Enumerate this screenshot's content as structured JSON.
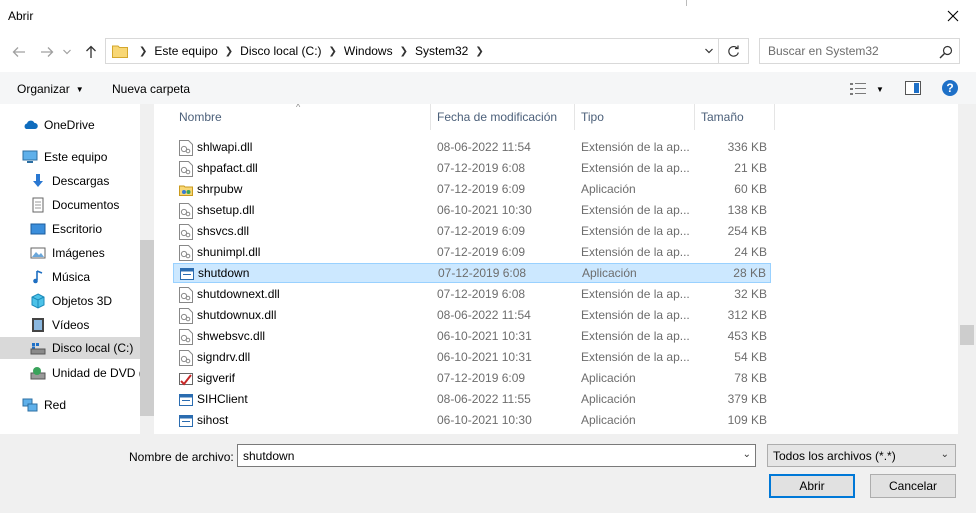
{
  "window": {
    "title": "Abrir"
  },
  "address": {
    "crumbs": [
      "Este equipo",
      "Disco local (C:)",
      "Windows",
      "System32"
    ]
  },
  "search": {
    "placeholder": "Buscar en System32"
  },
  "toolbar": {
    "organize_label": "Organizar",
    "new_folder_label": "Nueva carpeta"
  },
  "sidebar": {
    "items": [
      {
        "label": "OneDrive",
        "icon": "cloud-icon",
        "selected": false
      },
      {
        "label": "Este equipo",
        "icon": "computer-icon",
        "selected": false
      },
      {
        "label": "Descargas",
        "icon": "download-icon",
        "selected": false
      },
      {
        "label": "Documentos",
        "icon": "document-icon",
        "selected": false
      },
      {
        "label": "Escritorio",
        "icon": "desktop-icon",
        "selected": false
      },
      {
        "label": "Imágenes",
        "icon": "image-icon",
        "selected": false
      },
      {
        "label": "Música",
        "icon": "music-icon",
        "selected": false
      },
      {
        "label": "Objetos 3D",
        "icon": "cube-icon",
        "selected": false
      },
      {
        "label": "Vídeos",
        "icon": "video-icon",
        "selected": false
      },
      {
        "label": "Disco local (C:)",
        "icon": "drive-icon",
        "selected": true
      },
      {
        "label": "Unidad de DVD (",
        "icon": "dvd-icon",
        "selected": false
      },
      {
        "label": "Red",
        "icon": "network-icon",
        "selected": false
      }
    ]
  },
  "columns": {
    "name": "Nombre",
    "date": "Fecha de modificación",
    "type": "Tipo",
    "size": "Tamaño"
  },
  "files": [
    {
      "name": "shlwapi.dll",
      "date": "08-06-2022 11:54",
      "type": "Extensión de la ap...",
      "size": "336 KB",
      "icon": "dll-icon",
      "selected": false
    },
    {
      "name": "shpafact.dll",
      "date": "07-12-2019 6:08",
      "type": "Extensión de la ap...",
      "size": "21 KB",
      "icon": "dll-icon",
      "selected": false
    },
    {
      "name": "shrpubw",
      "date": "07-12-2019 6:09",
      "type": "Aplicación",
      "size": "60 KB",
      "icon": "share-folder-icon",
      "selected": false
    },
    {
      "name": "shsetup.dll",
      "date": "06-10-2021 10:30",
      "type": "Extensión de la ap...",
      "size": "138 KB",
      "icon": "dll-icon",
      "selected": false
    },
    {
      "name": "shsvcs.dll",
      "date": "07-12-2019 6:09",
      "type": "Extensión de la ap...",
      "size": "254 KB",
      "icon": "dll-icon",
      "selected": false
    },
    {
      "name": "shunimpl.dll",
      "date": "07-12-2019 6:09",
      "type": "Extensión de la ap...",
      "size": "24 KB",
      "icon": "dll-icon",
      "selected": false
    },
    {
      "name": "shutdown",
      "date": "07-12-2019 6:08",
      "type": "Aplicación",
      "size": "28 KB",
      "icon": "app-icon",
      "selected": true
    },
    {
      "name": "shutdownext.dll",
      "date": "07-12-2019 6:08",
      "type": "Extensión de la ap...",
      "size": "32 KB",
      "icon": "dll-icon",
      "selected": false
    },
    {
      "name": "shutdownux.dll",
      "date": "08-06-2022 11:54",
      "type": "Extensión de la ap...",
      "size": "312 KB",
      "icon": "dll-icon",
      "selected": false
    },
    {
      "name": "shwebsvc.dll",
      "date": "06-10-2021 10:31",
      "type": "Extensión de la ap...",
      "size": "453 KB",
      "icon": "dll-icon",
      "selected": false
    },
    {
      "name": "signdrv.dll",
      "date": "06-10-2021 10:31",
      "type": "Extensión de la ap...",
      "size": "54 KB",
      "icon": "dll-icon",
      "selected": false
    },
    {
      "name": "sigverif",
      "date": "07-12-2019 6:09",
      "type": "Aplicación",
      "size": "78 KB",
      "icon": "sigverif-icon",
      "selected": false
    },
    {
      "name": "SIHClient",
      "date": "08-06-2022 11:55",
      "type": "Aplicación",
      "size": "379 KB",
      "icon": "app-icon",
      "selected": false
    },
    {
      "name": "sihost",
      "date": "06-10-2021 10:30",
      "type": "Aplicación",
      "size": "109 KB",
      "icon": "app-icon",
      "selected": false
    }
  ],
  "bottom": {
    "filename_label": "Nombre de archivo:",
    "filename_value": "shutdown",
    "filter_value": "Todos los archivos (*.*)",
    "open_label": "Abrir",
    "cancel_label": "Cancelar"
  },
  "colors": {
    "accent": "#0078d7",
    "selection": "#cce8ff",
    "selection_border": "#99d1ff"
  }
}
